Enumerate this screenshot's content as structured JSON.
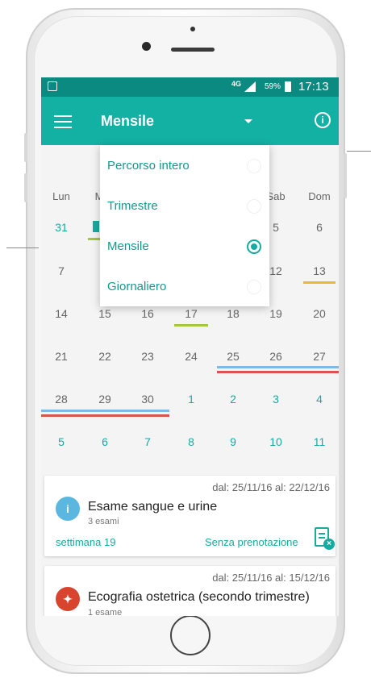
{
  "status_bar": {
    "network": "4G",
    "battery": "59%",
    "time": "17:13"
  },
  "toolbar": {
    "title": "Mensile"
  },
  "calendar": {
    "weekdays": [
      "Lun",
      "M",
      "",
      "",
      "",
      "Sab",
      "Dom"
    ],
    "rows": [
      [
        "31",
        "",
        "",
        "",
        "",
        "5",
        "6"
      ],
      [
        "7",
        "",
        "",
        "",
        "",
        "12",
        "13"
      ],
      [
        "14",
        "15",
        "16",
        "17",
        "18",
        "19",
        "20"
      ],
      [
        "21",
        "22",
        "23",
        "24",
        "25",
        "26",
        "27"
      ],
      [
        "28",
        "29",
        "30",
        "1",
        "2",
        "3",
        "4"
      ],
      [
        "5",
        "6",
        "7",
        "8",
        "9",
        "10",
        "11"
      ]
    ]
  },
  "view_dropdown": {
    "options": [
      "Percorso intero",
      "Trimestre",
      "Mensile",
      "Giornaliero"
    ],
    "selected": "Mensile"
  },
  "cards": [
    {
      "date_range": "dal: 25/11/16 al: 22/12/16",
      "title": "Esame sangue e urine",
      "subtitle": "3 esami",
      "week": "settimana 19",
      "status": "Senza prenotazione"
    },
    {
      "date_range": "dal: 25/11/16 al: 15/12/16",
      "title": "Ecografia ostetrica (secondo trimestre)",
      "subtitle": "1 esame"
    }
  ],
  "colors": {
    "toolbar": "#13b1a4",
    "status_bar": "#0a8a80",
    "accent": "#17aaa0",
    "bar_green": "#a4c639",
    "bar_orange": "#f2b33d",
    "bar_blue": "#7fb9e6",
    "bar_red": "#d9534f",
    "icon_blue": "#5bb7e0",
    "icon_red": "#d9442f"
  }
}
